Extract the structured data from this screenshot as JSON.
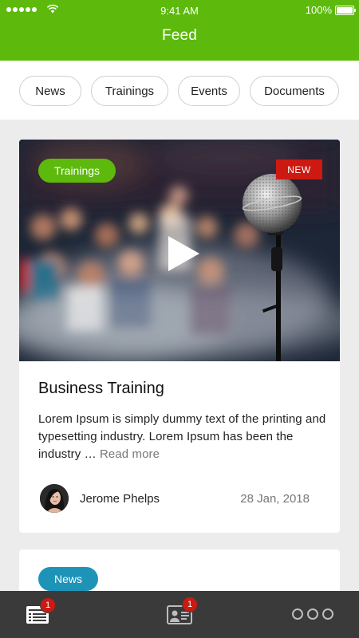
{
  "status_bar": {
    "time": "9:41 AM",
    "battery": "100%"
  },
  "header": {
    "title": "Feed"
  },
  "filters": [
    {
      "label": "News"
    },
    {
      "label": "Trainings"
    },
    {
      "label": "Events"
    },
    {
      "label": "Documents"
    }
  ],
  "feed": [
    {
      "category": "Trainings",
      "badge": "NEW",
      "title": "Business Training",
      "excerpt": "Lorem Ipsum is simply dummy text of the printing and typesetting industry. Lorem Ipsum has been the industry … ",
      "read_more": "Read more",
      "author": "Jerome Phelps",
      "date": "28 Jan, 2018"
    },
    {
      "category": "News"
    }
  ],
  "tabbar": {
    "feed_badge": "1",
    "contacts_badge": "1"
  },
  "colors": {
    "brand_green": "#5dba0c",
    "news_blue": "#1d93b8",
    "alert_red": "#cc1a12",
    "tabbar_bg": "#3a3a3a"
  }
}
